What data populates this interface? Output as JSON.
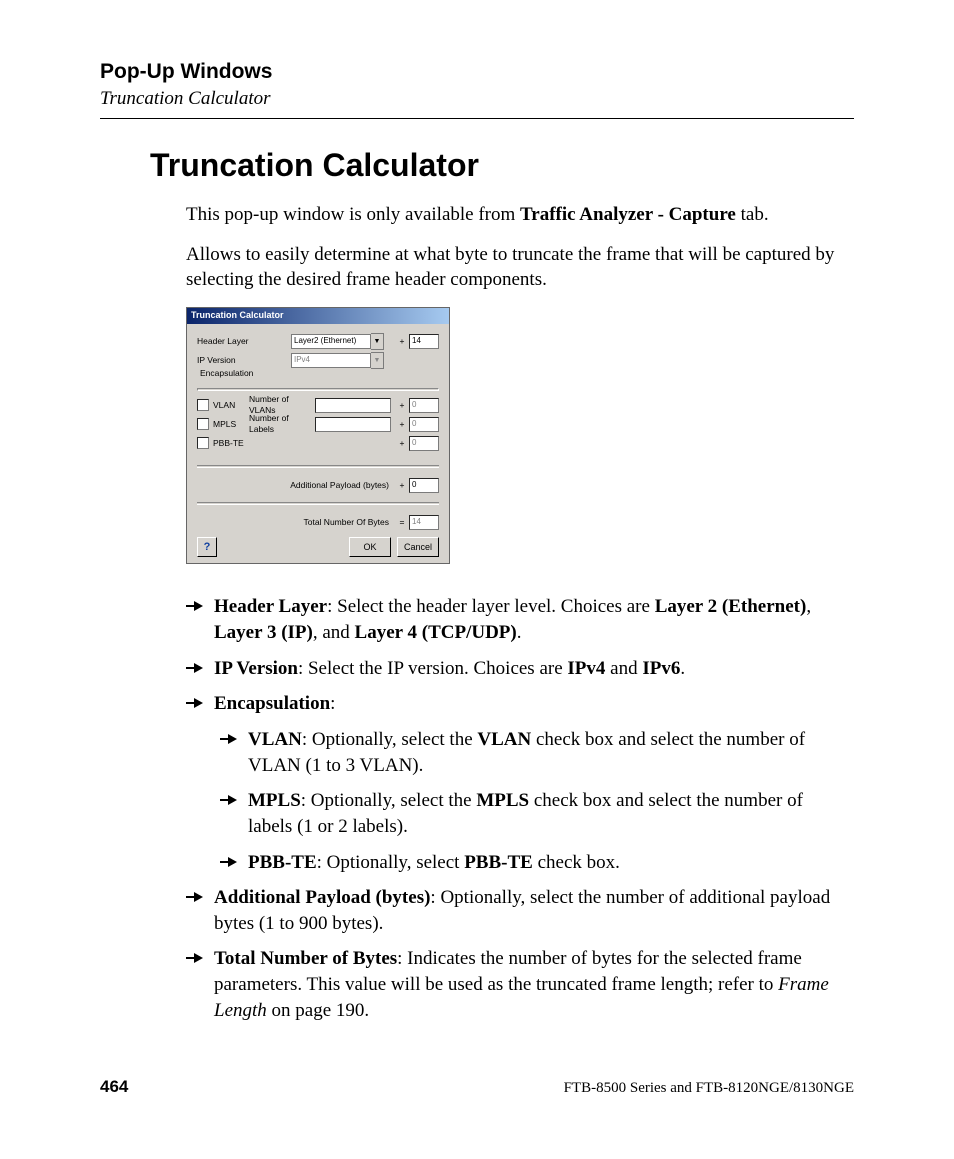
{
  "header": {
    "chapter": "Pop-Up Windows",
    "section": "Truncation Calculator"
  },
  "title": "Truncation Calculator",
  "intro": {
    "p1a": "This pop-up window is only available from ",
    "p1b": "Traffic Analyzer - Capture",
    "p1c": " tab.",
    "p2": "Allows to easily determine at what byte to truncate the frame that will be captured by selecting the desired frame header components."
  },
  "dialog": {
    "title": "Truncation Calculator",
    "header_layer": {
      "label": "Header Layer",
      "value": "Layer2 (Ethernet)",
      "bytes": "14"
    },
    "ip_version": {
      "label": "IP Version",
      "value": "IPv4"
    },
    "encapsulation_label": "Encapsulation",
    "vlan": {
      "chk_label": "VLAN",
      "nlabel": "Number of VLANs",
      "bytes": "0"
    },
    "mpls": {
      "chk_label": "MPLS",
      "nlabel": "Number of Labels",
      "bytes": "0"
    },
    "pbbte": {
      "chk_label": "PBB-TE",
      "bytes": "0"
    },
    "addl": {
      "label": "Additional Payload (bytes)",
      "op": "+",
      "value": "0"
    },
    "total": {
      "label": "Total Number Of Bytes",
      "op": "=",
      "value": "14"
    },
    "ok": "OK",
    "cancel": "Cancel",
    "plus": "+"
  },
  "bullets": {
    "b1": {
      "t": "Header Layer",
      "r": ": Select the header layer level. Choices are ",
      "c1": "Layer 2 (Ethernet)",
      "s1": ", ",
      "c2": "Layer 3 (IP)",
      "s2": ", and ",
      "c3": "Layer 4 (TCP/UDP)",
      "end": "."
    },
    "b2": {
      "t": "IP Version",
      "r": ": Select the IP version. Choices are ",
      "c1": "IPv4",
      "s1": " and ",
      "c2": "IPv6",
      "end": "."
    },
    "b3": {
      "t": "Encapsulation",
      "r": ":"
    },
    "b3a": {
      "t": "VLAN",
      "r": ": Optionally, select the ",
      "c1": "VLAN",
      "r2": " check box and select the number of VLAN (1 to 3 VLAN)."
    },
    "b3b": {
      "t": "MPLS",
      "r": ": Optionally, select the ",
      "c1": "MPLS",
      "r2": " check box and select the number of labels (1 or 2 labels)."
    },
    "b3c": {
      "t": "PBB-TE",
      "r": ": Optionally, select ",
      "c1": "PBB-TE",
      "r2": " check box."
    },
    "b4": {
      "t": "Additional Payload (bytes)",
      "r": ": Optionally, select the number of additional payload bytes (1 to 900 bytes)."
    },
    "b5": {
      "t": "Total Number of Bytes",
      "r": ": Indicates the number of bytes for the selected frame parameters. This value will be used as the truncated frame length; refer to ",
      "it": "Frame Length",
      "r2": " on page 190."
    }
  },
  "footer": {
    "page": "464",
    "product": "FTB-8500 Series and FTB-8120NGE/8130NGE"
  }
}
